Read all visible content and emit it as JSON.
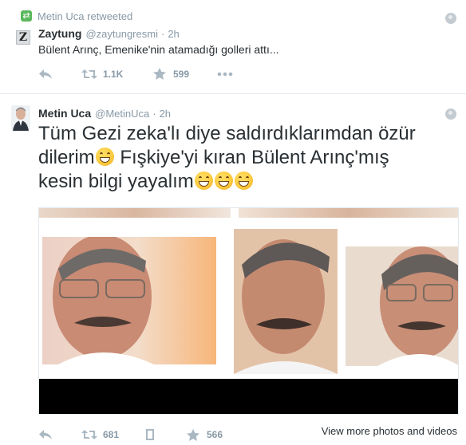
{
  "tweet1": {
    "retweet_context": "Metin Uca retweeted",
    "author_name": "Zaytung",
    "author_handle": "@zaytungresmi",
    "timestamp": "2h",
    "avatar_letter": "Z",
    "text": "Bülent Arınç, Emenike'nin atamadığı golleri attı...",
    "retweet_count": "1.1K",
    "favorite_count": "599"
  },
  "tweet2": {
    "author_name": "Metin Uca",
    "author_handle": "@MetinUca",
    "timestamp": "2h",
    "text_line1": "Tüm Gezi zeka'lı diye saldırdıklarımdan özür",
    "text_line2_a": "dilerim",
    "text_line2_b": " Fışkiye'yi kıran Bülent Arınç'mış",
    "text_line3": "kesin bilgi yayalım",
    "retweet_count": "681",
    "favorite_count": "566",
    "view_more_label": "View more photos and videos"
  },
  "icons": {
    "reply": "reply-icon",
    "retweet": "retweet-icon",
    "favorite": "star-icon",
    "more": "more-dots-icon",
    "globe": "globe-icon",
    "emoji": "grinning-face-emoji"
  },
  "colors": {
    "muted": "#8899a6",
    "text": "#292f33",
    "retweet_badge": "#5bb85d",
    "divider": "#e1e8ed"
  }
}
